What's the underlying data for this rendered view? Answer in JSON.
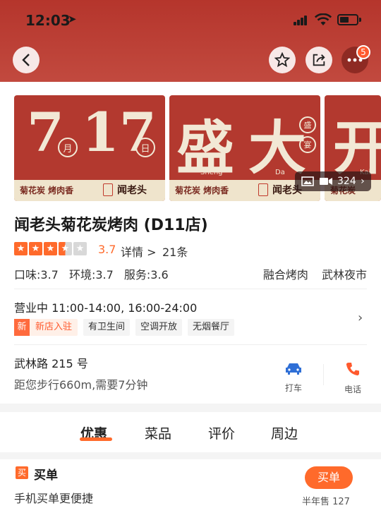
{
  "status_bar": {
    "time": "12:03",
    "location_arrow": "➤"
  },
  "nav": {
    "badge_count": "5"
  },
  "photos": {
    "photo1": {
      "big_month": "7",
      "month_circle": "月",
      "big_day": "17",
      "day_circle": "日",
      "strip_text": "菊花炭 烤肉香",
      "signature": "闻老头"
    },
    "photo2": {
      "big_left": "盛",
      "big_right": "大",
      "pinyin_left": "Sheng",
      "pinyin_right": "Da",
      "circle_top": "盛",
      "circle_bottom": "宴",
      "strip_text": "菊花炭 烤肉香",
      "signature": "闻老头"
    },
    "photo3": {
      "big": "开",
      "pinyin": "Kai",
      "strip_text": "菊花炭"
    },
    "counter": "324"
  },
  "shop": {
    "name": "闻老头菊花炭烤肉 (D11店)",
    "rating": "3.7",
    "stars_filled": 3.5,
    "detail_label": "详情",
    "detail_arrow": ">",
    "review_count": "21条",
    "scores": {
      "taste": "口味:3.7",
      "environment": "环境:3.7",
      "service": "服务:3.6"
    },
    "category": "融合烤肉",
    "area": "武林夜市"
  },
  "hours": {
    "text": "营业中 11:00-14:00, 16:00-24:00"
  },
  "facilities": {
    "new_icon": "新",
    "new_label": "新店入驻",
    "items": [
      "有卫生间",
      "空调开放",
      "无烟餐厅"
    ]
  },
  "location": {
    "address": "武林路 215 号",
    "distance": "距您步行660m,需要7分钟",
    "taxi_label": "打车",
    "phone_label": "电话"
  },
  "tabs": [
    "优惠",
    "菜品",
    "评价",
    "周边"
  ],
  "buy": {
    "icon": "买",
    "title": "买单",
    "desc": "手机买单更便捷",
    "button": "买单",
    "sold": "半年售 127"
  },
  "colors": {
    "brand_red": "#b5352c",
    "accent_orange": "#ff6a2b",
    "star_orange": "#ff6a2b"
  }
}
